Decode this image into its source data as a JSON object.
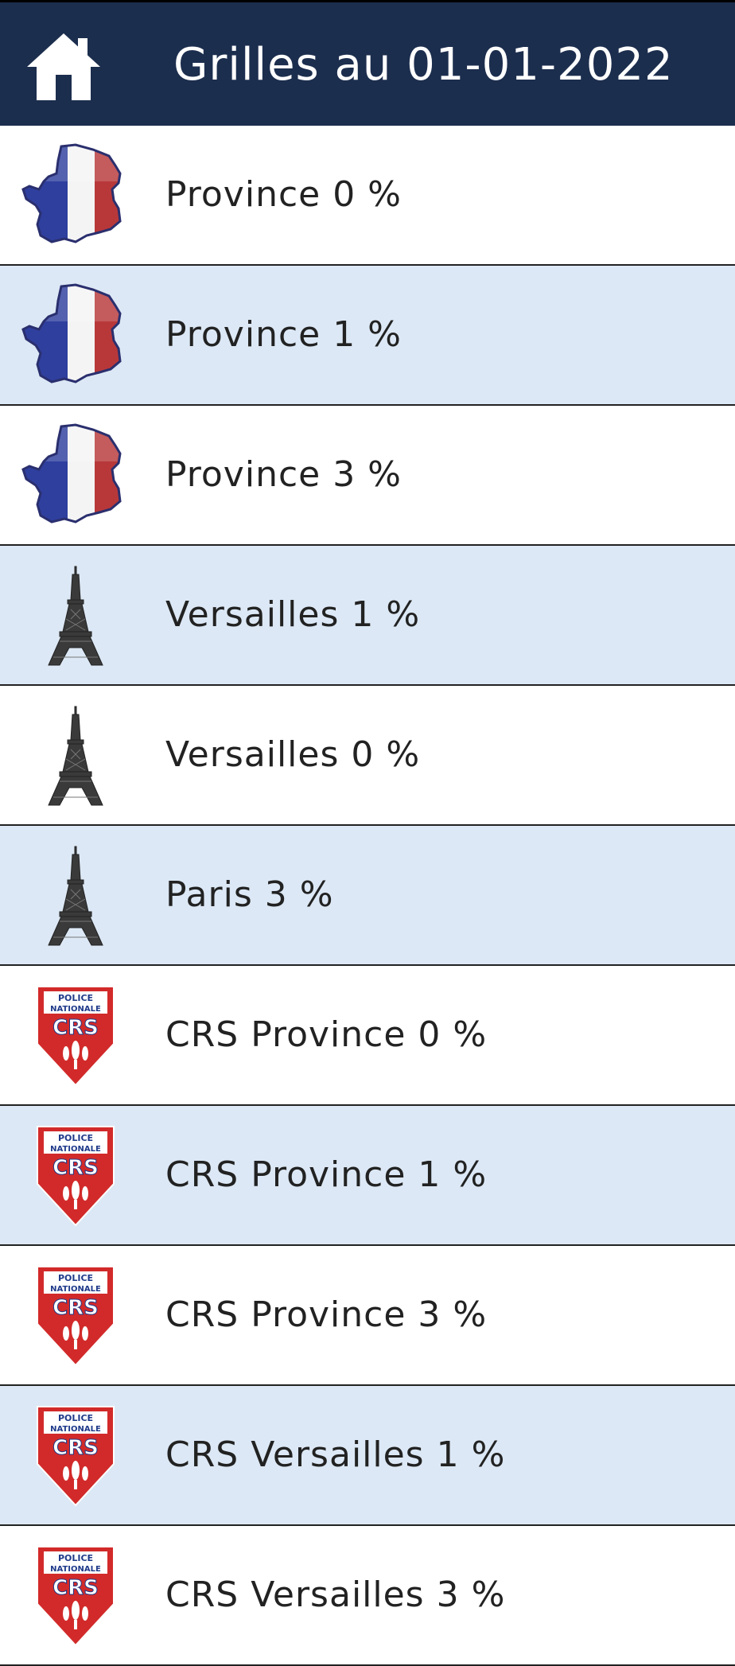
{
  "header": {
    "title": "Grilles au 01-01-2022",
    "home_icon": "house-icon",
    "background": "#1c2e4e"
  },
  "rows": [
    {
      "label": "Province 0 %",
      "icon": "france-flag-map-icon"
    },
    {
      "label": "Province 1 %",
      "icon": "france-flag-map-icon"
    },
    {
      "label": "Province 3 %",
      "icon": "france-flag-map-icon"
    },
    {
      "label": "Versailles 1 %",
      "icon": "eiffel-tower-icon"
    },
    {
      "label": "Versailles 0 %",
      "icon": "eiffel-tower-icon"
    },
    {
      "label": "Paris 3 %",
      "icon": "eiffel-tower-icon"
    },
    {
      "label": "CRS Province 0 %",
      "icon": "crs-badge-icon"
    },
    {
      "label": "CRS Province 1 %",
      "icon": "crs-badge-icon"
    },
    {
      "label": "CRS Province 3 %",
      "icon": "crs-badge-icon"
    },
    {
      "label": "CRS Versailles 1 %",
      "icon": "crs-badge-icon"
    },
    {
      "label": "CRS Versailles 3 %",
      "icon": "crs-badge-icon"
    }
  ],
  "colors": {
    "row_alt": "#dce8f5",
    "row_default": "#ffffff",
    "divider": "#222222"
  }
}
